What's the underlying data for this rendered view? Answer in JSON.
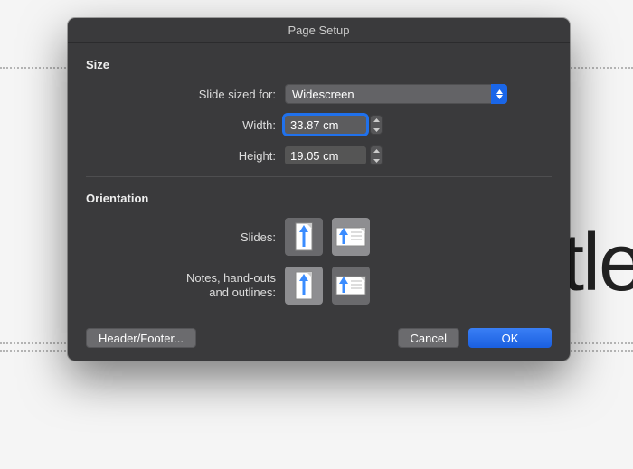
{
  "dialog": {
    "title": "Page Setup",
    "section_size": "Size",
    "section_orientation": "Orientation",
    "labels": {
      "sized_for": "Slide sized for:",
      "width": "Width:",
      "height": "Height:",
      "slides": "Slides:",
      "notes": "Notes, hand-outs\nand outlines:"
    },
    "sized_for_value": "Widescreen",
    "width_value": "33.87 cm",
    "height_value": "19.05 cm",
    "buttons": {
      "header_footer": "Header/Footer...",
      "cancel": "Cancel",
      "ok": "OK"
    }
  },
  "background": {
    "partial_text": "tle"
  }
}
